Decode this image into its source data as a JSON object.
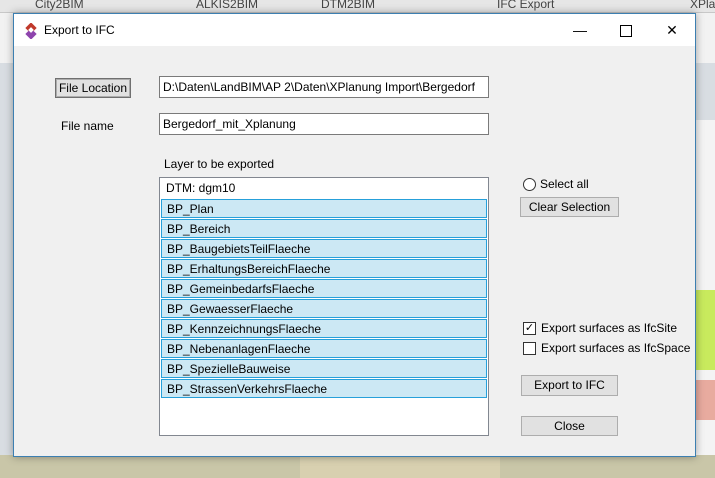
{
  "background": {
    "tabs": [
      "City2BIM",
      "ALKIS2BIM",
      "DTM2BIM",
      "IFC Export",
      "XPla"
    ]
  },
  "window": {
    "title": "Export to IFC",
    "minimize_glyph": "—",
    "close_glyph": "✕"
  },
  "form": {
    "file_location_button": "File Location",
    "file_location_value": "D:\\Daten\\LandBIM\\AP 2\\Daten\\XPlanung Import\\Bergedorf",
    "file_name_label": "File name",
    "file_name_value": "Bergedorf_mit_Xplanung",
    "layers_label": "Layer to be exported",
    "layers": [
      {
        "label": "DTM: dgm10",
        "selected": false
      },
      {
        "label": "BP_Plan",
        "selected": true
      },
      {
        "label": "BP_Bereich",
        "selected": true
      },
      {
        "label": "BP_BaugebietsTeilFlaeche",
        "selected": true
      },
      {
        "label": "BP_ErhaltungsBereichFlaeche",
        "selected": true
      },
      {
        "label": "BP_GemeinbedarfsFlaeche",
        "selected": true
      },
      {
        "label": "BP_GewaesserFlaeche",
        "selected": true
      },
      {
        "label": "BP_KennzeichnungsFlaeche",
        "selected": true
      },
      {
        "label": "BP_NebenanlagenFlaeche",
        "selected": true
      },
      {
        "label": "BP_SpezielleBauweise",
        "selected": true
      },
      {
        "label": "BP_StrassenVerkehrsFlaeche",
        "selected": true
      }
    ]
  },
  "options": {
    "select_all_label": "Select all",
    "select_all_checked": false,
    "clear_selection_button": "Clear Selection",
    "export_ifcsite_label": "Export surfaces as IfcSite",
    "export_ifcsite_checked": true,
    "export_ifcspace_label": "Export surfaces as IfcSpace",
    "export_ifcspace_checked": false,
    "checkmark": "✓",
    "export_button": "Export to IFC",
    "close_button": "Close"
  }
}
